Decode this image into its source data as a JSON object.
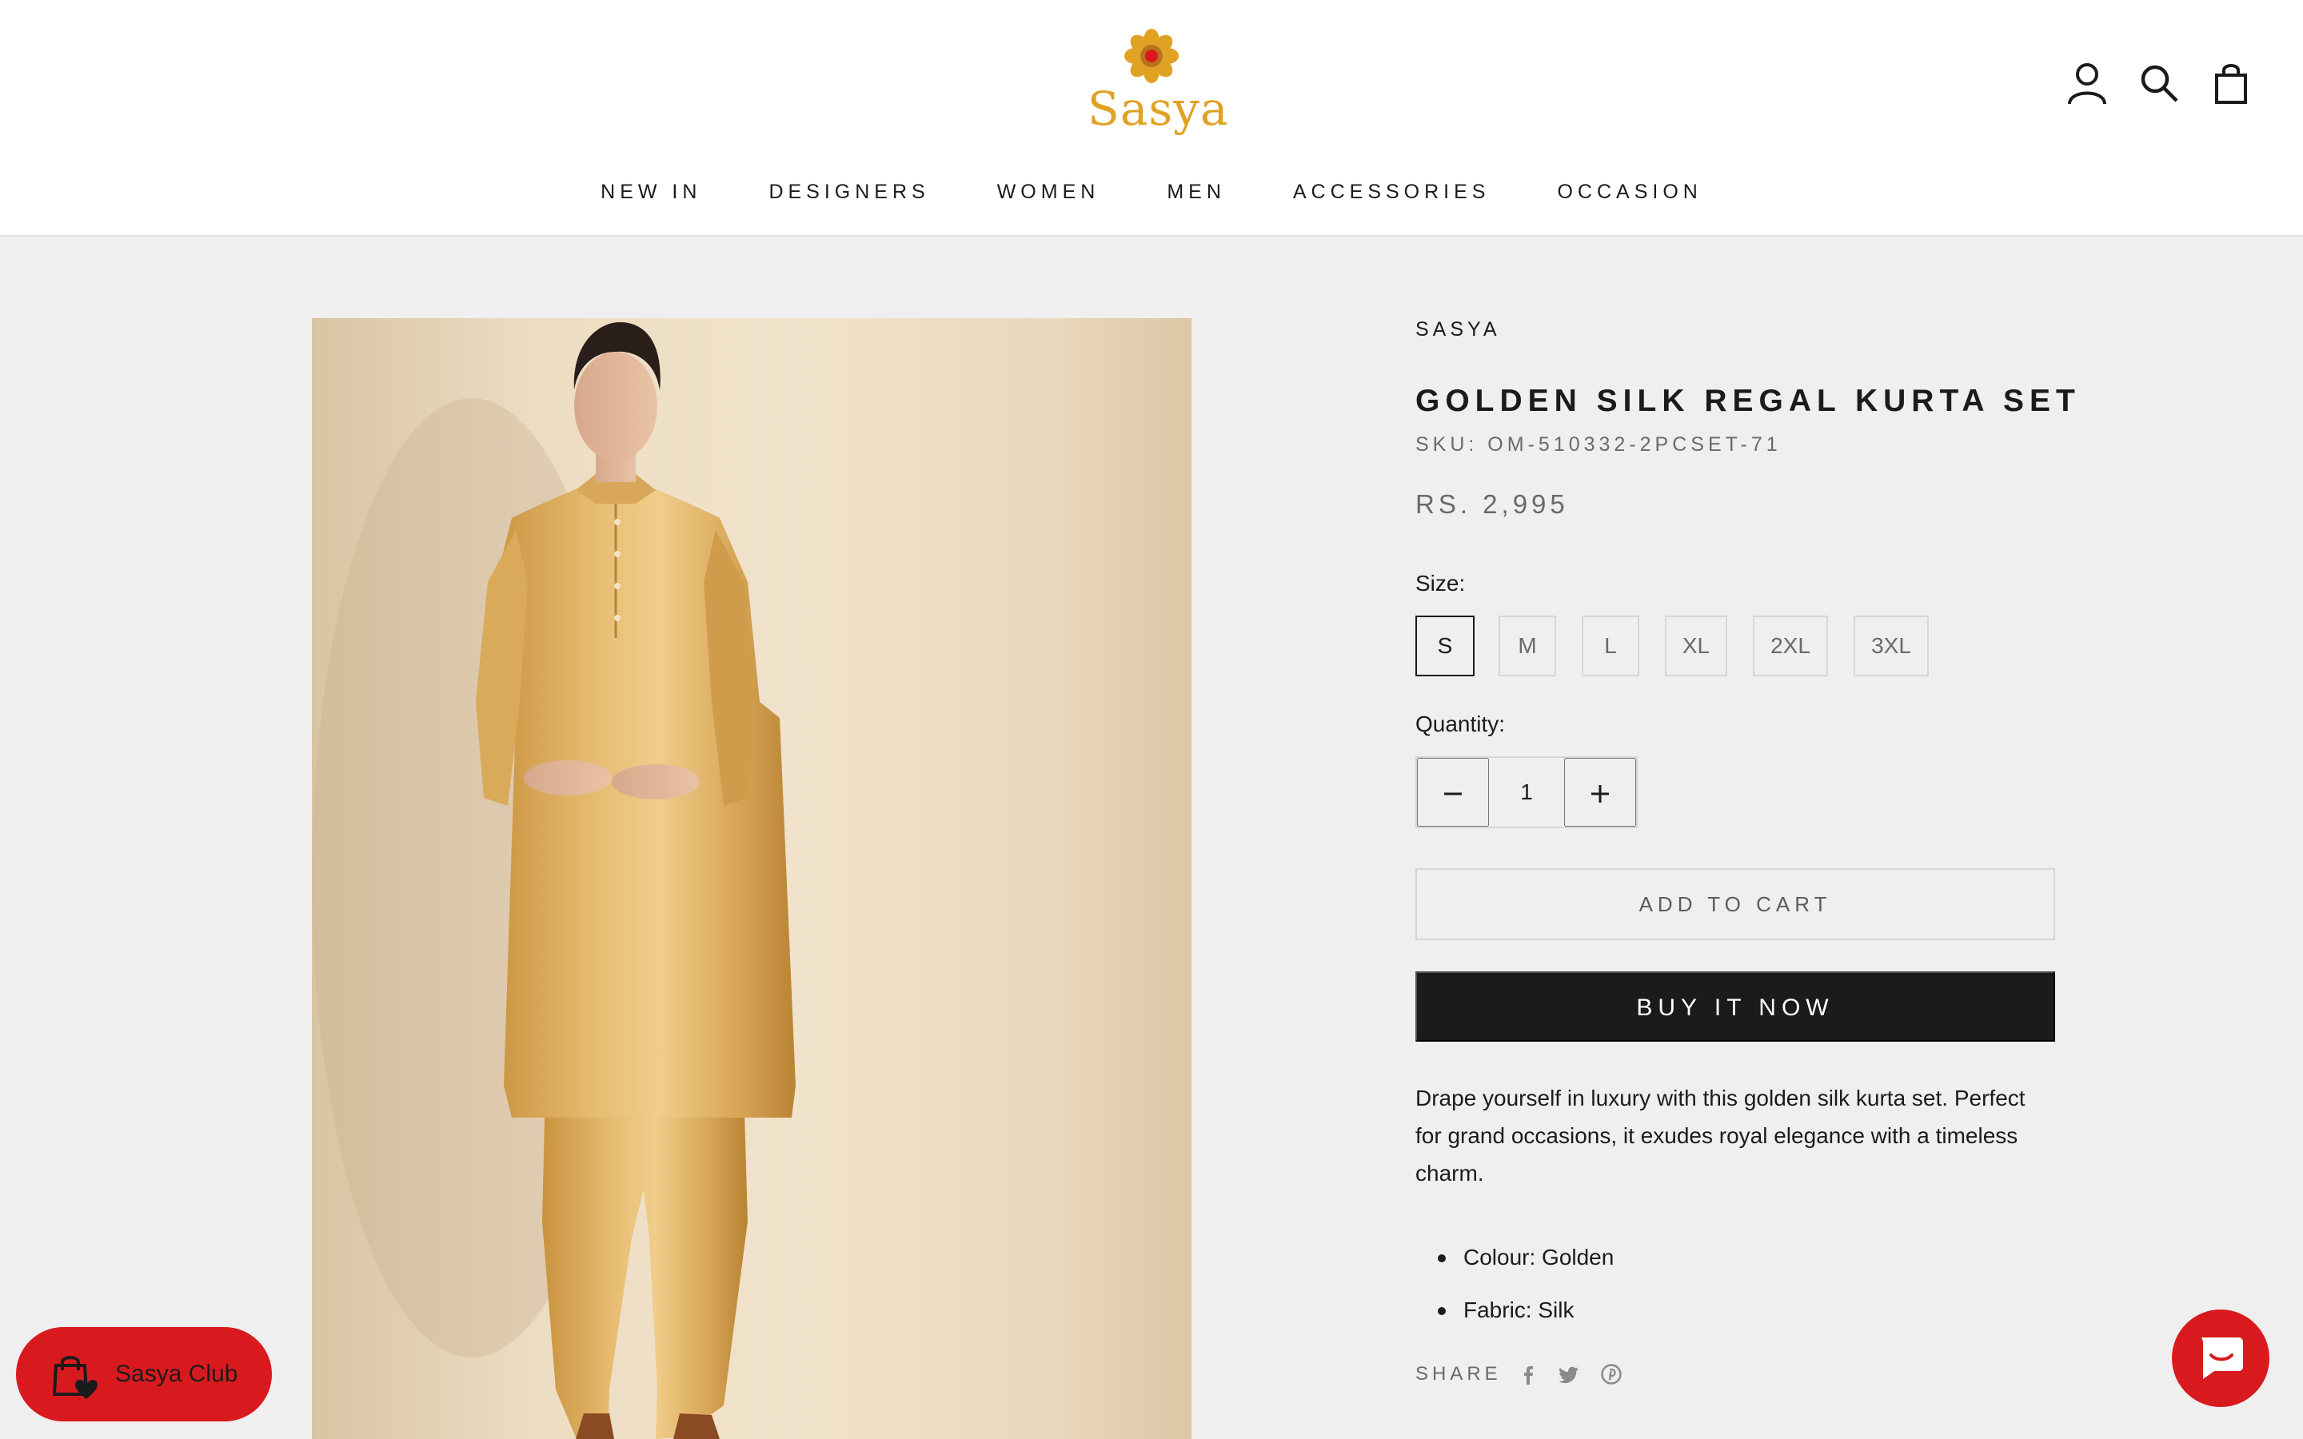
{
  "brand": {
    "name": "Sasya",
    "accent_color": "#e0a224"
  },
  "header": {
    "icons": [
      "account-icon",
      "search-icon",
      "cart-icon"
    ],
    "nav": [
      "NEW IN",
      "DESIGNERS",
      "WOMEN",
      "MEN",
      "ACCESSORIES",
      "OCCASION"
    ]
  },
  "product": {
    "vendor": "SASYA",
    "title": "GOLDEN SILK REGAL KURTA SET",
    "sku": "SKU: OM-510332-2PCSET-71",
    "price": "RS. 2,995",
    "size_label": "Size:",
    "sizes": [
      "S",
      "M",
      "L",
      "XL",
      "2XL",
      "3XL"
    ],
    "selected_size": "S",
    "quantity_label": "Quantity:",
    "quantity": "1",
    "add_to_cart": "ADD TO CART",
    "buy_now": "BUY IT NOW",
    "description": "Drape yourself in luxury with this golden silk kurta set. Perfect for grand occasions, it exudes royal elegance with a timeless charm.",
    "bullets": [
      "Colour: Golden",
      "Fabric: Silk"
    ],
    "share_label": "SHARE",
    "share_icons": [
      "facebook-icon",
      "twitter-icon",
      "pinterest-icon"
    ]
  },
  "widgets": {
    "club_label": "Sasya Club",
    "accent_red": "#d81a1f"
  }
}
